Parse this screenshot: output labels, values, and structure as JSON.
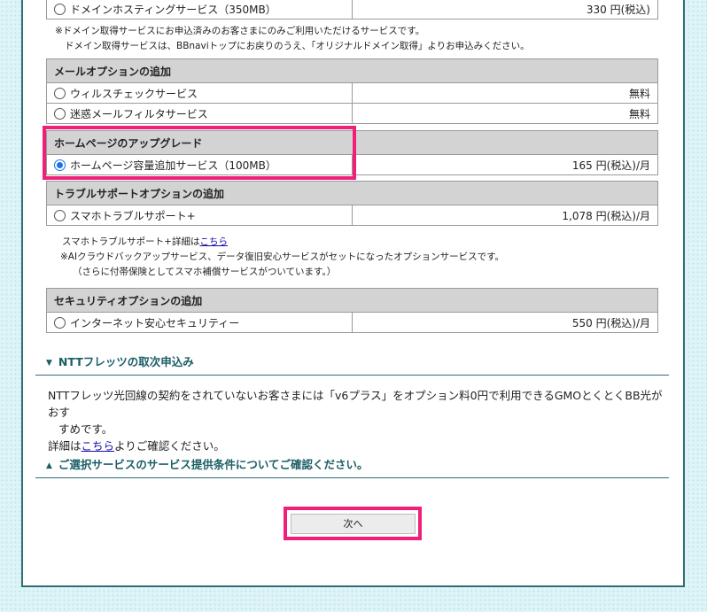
{
  "domain_options": {
    "items": [
      {
        "label": "ドメインホスティングサービス（350MB）",
        "price": "330 円(税込)"
      }
    ],
    "note_line1": "※ドメイン取得サービスにお申込済みのお客さまにのみご利用いただけるサービスです。",
    "note_line2": "ドメイン取得サービスは、BBnaviトップにお戻りのうえ、「オリジナルドメイン取得」よりお申込みください。"
  },
  "mail_options": {
    "header": "メールオプションの追加",
    "items": [
      {
        "label": "ウィルスチェックサービス",
        "price": "無料"
      },
      {
        "label": "迷惑メールフィルタサービス",
        "price": "無料"
      }
    ]
  },
  "homepage_upgrade": {
    "header": "ホームページのアップグレード",
    "items": [
      {
        "label": "ホームページ容量追加サービス（100MB）",
        "price": "165 円(税込)/月",
        "selected": true
      }
    ]
  },
  "trouble_support": {
    "header": "トラブルサポートオプションの追加",
    "items": [
      {
        "label": "スマホトラブルサポート+",
        "price": "1,078 円(税込)/月"
      }
    ],
    "note_prefix": "スマホトラブルサポート+詳細は",
    "note_link": "こちら",
    "note_line2": "※AIクラウドバックアップサービス、データ復旧安心サービスがセットになったオプションサービスです。",
    "note_line3": "（さらに付帯保険としてスマホ補償サービスがついています。）"
  },
  "security": {
    "header": "セキュリティオプションの追加",
    "items": [
      {
        "label": "インターネット安心セキュリティー",
        "price": "550 円(税込)/月"
      }
    ]
  },
  "ntt": {
    "title": "NTTフレッツの取次申込み",
    "text1": "NTTフレッツ光回線の契約をされていないお客さまには「v6プラス」をオプション料0円で利用できるGMOとくとくBB光がおす",
    "text1b": "すめです。",
    "text2_prefix": "詳細は",
    "text2_link": "こちら",
    "text2_suffix": "よりご確認ください。"
  },
  "conditions": {
    "title": "ご選択サービスのサービス提供条件についてご確認ください。"
  },
  "next_button": "次へ",
  "accent_color": "#f0207a",
  "radio_selected_color": "#1a73e8"
}
